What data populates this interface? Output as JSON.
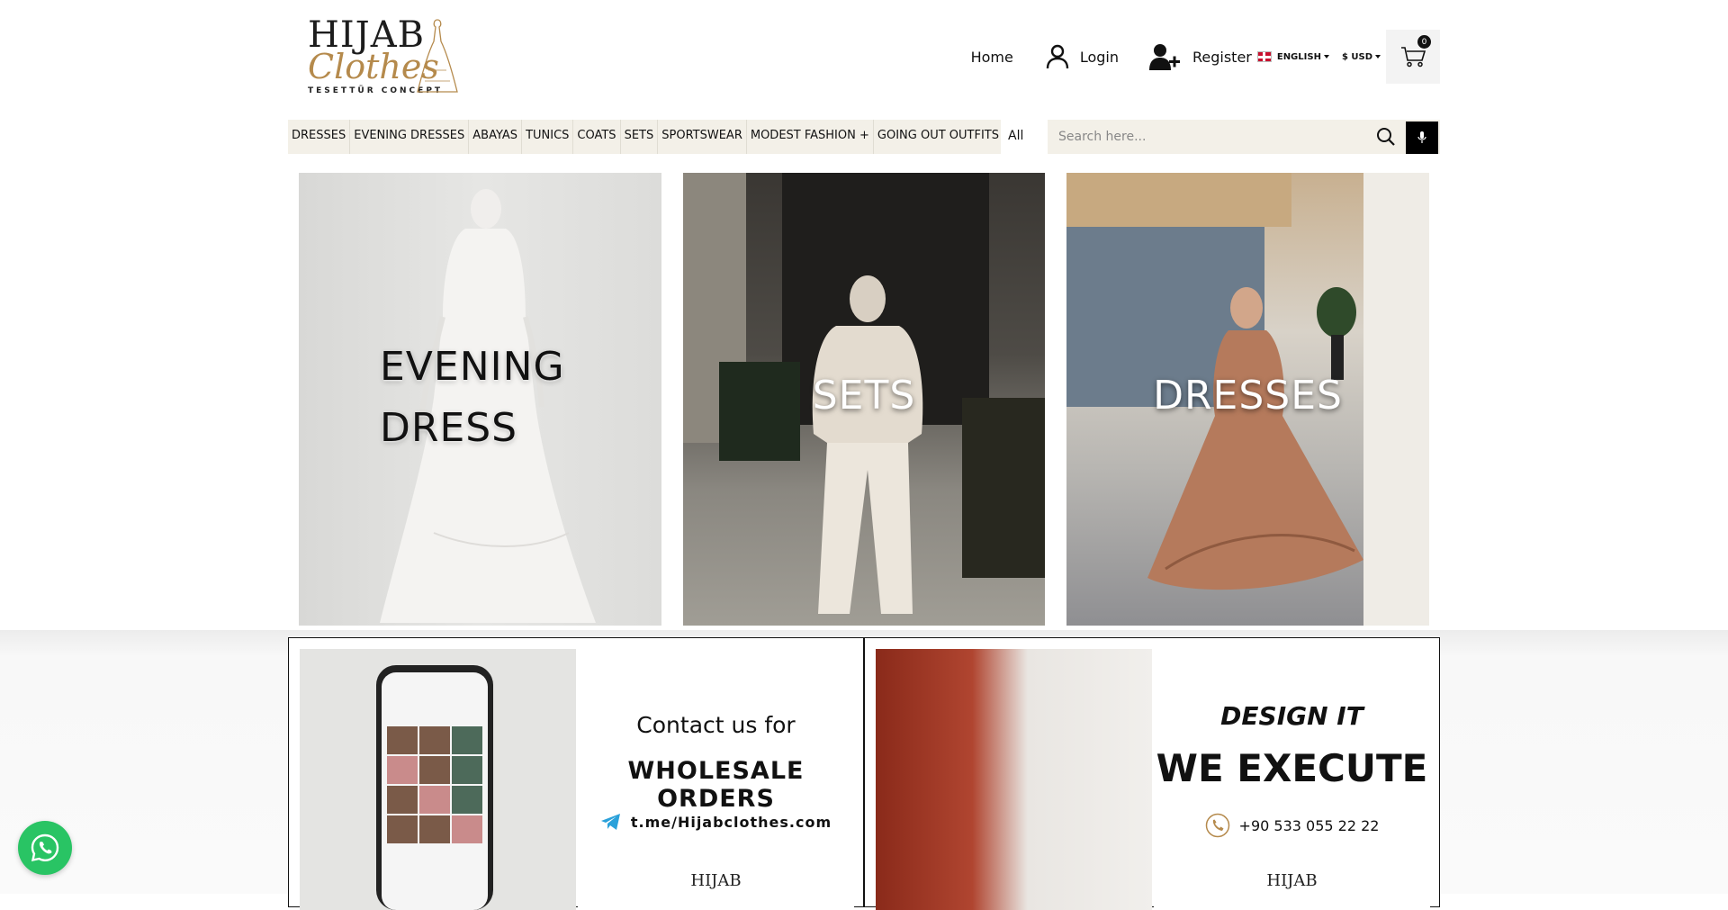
{
  "logo": {
    "line1": "HIJAB",
    "line2": "Clothes",
    "line3": "TESETTÜR CONCEPT"
  },
  "topnav": {
    "home": "Home",
    "login": "Login",
    "register": "Register",
    "language": "ENGLISH",
    "currency": "$ USD",
    "cart_count": "0"
  },
  "categories": [
    "DRESSES",
    "EVENING DRESSES",
    "ABAYAS",
    "TUNICS",
    "COATS",
    "SETS",
    "SPORTSWEAR",
    "MODEST FASHION +",
    "GOING OUT OUTFITS +"
  ],
  "search": {
    "scope": "All",
    "placeholder": "Search here..."
  },
  "tiles": {
    "evening_line1": "EVENING",
    "evening_line2": "DRESS",
    "sets": "SETS",
    "dresses": "DRESSES"
  },
  "promo_wholesale": {
    "line1": "Contact us for",
    "line2": "WHOLESALE ORDERS",
    "link": "t.me/Hijabclothes.com",
    "brand": "HIJAB"
  },
  "promo_design": {
    "line1": "DESIGN IT",
    "line2": "WE EXECUTE",
    "phone": "+90 533 055 22 22",
    "brand": "HIJAB"
  },
  "colors": {
    "accent_gold": "#b58a4c",
    "category_bar": "#f3f0e8",
    "whatsapp": "#29c464"
  }
}
